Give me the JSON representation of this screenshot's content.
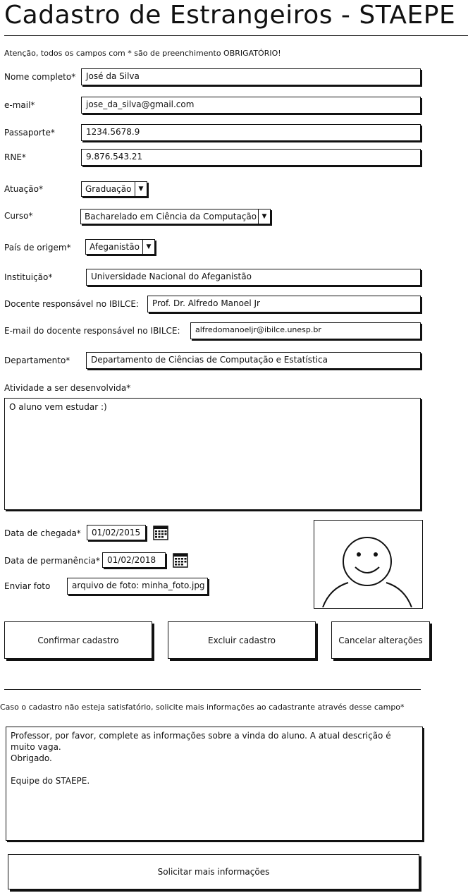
{
  "header": {
    "title": "Cadastro de Estrangeiros - STAEPE"
  },
  "notice": "Atenção, todos os campos com * são de preenchimento OBRIGATÓRIO!",
  "form": {
    "nome": {
      "label": "Nome completo*",
      "value": "José da Silva"
    },
    "email": {
      "label": "e-mail*",
      "value": "jose_da_silva@gmail.com"
    },
    "passaporte": {
      "label": "Passaporte*",
      "value": "1234.5678.9"
    },
    "rne": {
      "label": "RNE*",
      "value": "9.876.543.21"
    },
    "atuacao": {
      "label": "Atuação*",
      "value": "Graduação"
    },
    "curso": {
      "label": "Curso*",
      "value": "Bacharelado em Ciência da Computação"
    },
    "pais": {
      "label": "País de origem*",
      "value": "Afeganistão"
    },
    "instituicao": {
      "label": "Instituição*",
      "value": "Universidade Nacional do Afeganistão"
    },
    "docente": {
      "label": "Docente responsável no IBILCE:",
      "value": "Prof. Dr. Alfredo Manoel Jr"
    },
    "email_docente": {
      "label": "E-mail do docente responsável no IBILCE:",
      "value": "alfredomanoeljr@ibilce.unesp.br"
    },
    "departamento": {
      "label": "Departamento*",
      "value": "Departamento de Ciências de Computação e Estatística"
    },
    "atividade": {
      "label": "Atividade a ser desenvolvida*",
      "value": "O aluno vem estudar :)"
    },
    "chegada": {
      "label": "Data de chegada*",
      "value": "01/02/2015"
    },
    "permanencia": {
      "label": "Data de permanência*",
      "value": "01/02/2018"
    },
    "foto": {
      "label": "Enviar foto",
      "value": "arquivo de foto: minha_foto.jpg"
    }
  },
  "icons": {
    "calendar": "calendar-icon",
    "dropdown": "chevron-down-icon",
    "photo": "user-avatar-icon"
  },
  "actions": {
    "confirmar": "Confirmar cadastro",
    "excluir": "Excluir cadastro",
    "cancelar": "Cancelar alterações"
  },
  "feedback": {
    "label": "Caso o cadastro não esteja satisfatório, solicite mais informações ao cadastrante através desse campo*",
    "value": "Professor, por favor, complete as informações sobre a vinda do aluno. A atual descrição é muito vaga.\nObrigado.\n\nEquipe do STAEPE.",
    "button": "Solicitar mais informações"
  }
}
